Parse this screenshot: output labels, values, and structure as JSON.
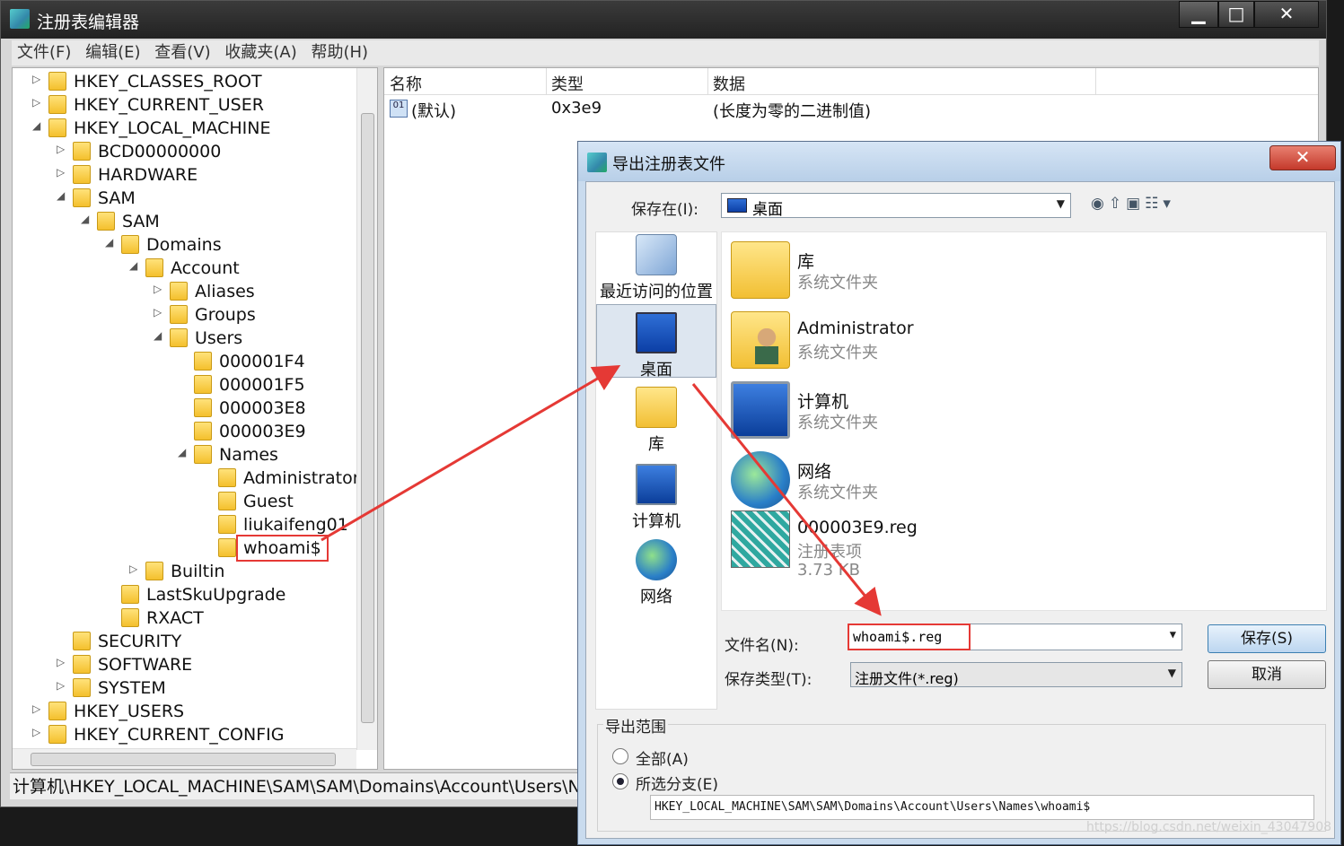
{
  "window": {
    "title": "注册表编辑器",
    "min": "▁",
    "max": "□",
    "close": "✕"
  },
  "menu": [
    "文件(F)",
    "编辑(E)",
    "查看(V)",
    "收藏夹(A)",
    "帮助(H)"
  ],
  "tree": [
    {
      "label": "HKEY_CLASSES_ROOT",
      "depth": 0,
      "arrow": "▷"
    },
    {
      "label": "HKEY_CURRENT_USER",
      "depth": 0,
      "arrow": "▷"
    },
    {
      "label": "HKEY_LOCAL_MACHINE",
      "depth": 0,
      "arrow": "◢"
    },
    {
      "label": "BCD00000000",
      "depth": 1,
      "arrow": "▷"
    },
    {
      "label": "HARDWARE",
      "depth": 1,
      "arrow": "▷"
    },
    {
      "label": "SAM",
      "depth": 1,
      "arrow": "◢"
    },
    {
      "label": "SAM",
      "depth": 2,
      "arrow": "◢"
    },
    {
      "label": "Domains",
      "depth": 3,
      "arrow": "◢"
    },
    {
      "label": "Account",
      "depth": 4,
      "arrow": "◢"
    },
    {
      "label": "Aliases",
      "depth": 5,
      "arrow": "▷"
    },
    {
      "label": "Groups",
      "depth": 5,
      "arrow": "▷"
    },
    {
      "label": "Users",
      "depth": 5,
      "arrow": "◢"
    },
    {
      "label": "000001F4",
      "depth": 6,
      "arrow": ""
    },
    {
      "label": "000001F5",
      "depth": 6,
      "arrow": ""
    },
    {
      "label": "000003E8",
      "depth": 6,
      "arrow": ""
    },
    {
      "label": "000003E9",
      "depth": 6,
      "arrow": ""
    },
    {
      "label": "Names",
      "depth": 6,
      "arrow": "◢"
    },
    {
      "label": "Administrator",
      "depth": 7,
      "arrow": ""
    },
    {
      "label": "Guest",
      "depth": 7,
      "arrow": ""
    },
    {
      "label": "liukaifeng01",
      "depth": 7,
      "arrow": ""
    },
    {
      "label": "whoami$",
      "depth": 7,
      "arrow": "",
      "selected": true
    },
    {
      "label": "Builtin",
      "depth": 4,
      "arrow": "▷"
    },
    {
      "label": "LastSkuUpgrade",
      "depth": 3,
      "arrow": ""
    },
    {
      "label": "RXACT",
      "depth": 3,
      "arrow": ""
    },
    {
      "label": "SECURITY",
      "depth": 1,
      "arrow": ""
    },
    {
      "label": "SOFTWARE",
      "depth": 1,
      "arrow": "▷"
    },
    {
      "label": "SYSTEM",
      "depth": 1,
      "arrow": "▷"
    },
    {
      "label": "HKEY_USERS",
      "depth": 0,
      "arrow": "▷"
    },
    {
      "label": "HKEY_CURRENT_CONFIG",
      "depth": 0,
      "arrow": "▷"
    }
  ],
  "list": {
    "col_name": "名称",
    "col_type": "类型",
    "col_data": "数据",
    "row_name": "(默认)",
    "row_type": "0x3e9",
    "row_data": "(长度为零的二进制值)"
  },
  "status": "计算机\\HKEY_LOCAL_MACHINE\\SAM\\SAM\\Domains\\Account\\Users\\Names\\whoami$",
  "dialog": {
    "title": "导出注册表文件",
    "close": "✕",
    "save_in_label": "保存在(I):",
    "save_in_value": "桌面",
    "toolbar_icons": "◉⇧▣☷▾",
    "places": [
      "最近访问的位置",
      "桌面",
      "库",
      "计算机",
      "网络"
    ],
    "files": [
      {
        "name": "库",
        "sub": "系统文件夹"
      },
      {
        "name": "Administrator",
        "sub": "系统文件夹"
      },
      {
        "name": "计算机",
        "sub": "系统文件夹"
      },
      {
        "name": "网络",
        "sub": "系统文件夹"
      },
      {
        "name": "000003E9.reg",
        "sub": "注册表项",
        "sub2": "3.73 KB"
      }
    ],
    "filename_label": "文件名(N):",
    "filename_value": "whoami$.reg",
    "filetype_label": "保存类型(T):",
    "filetype_value": "注册文件(*.reg)",
    "save_button": "保存(S)",
    "cancel_button": "取消",
    "scope_title": "导出范围",
    "scope_all": "全部(A)",
    "scope_selected": "所选分支(E)",
    "branch_path": "HKEY_LOCAL_MACHINE\\SAM\\SAM\\Domains\\Account\\Users\\Names\\whoami$"
  },
  "watermark": "https://blog.csdn.net/weixin_43047908",
  "colors": {
    "highlight": "#e53935"
  }
}
